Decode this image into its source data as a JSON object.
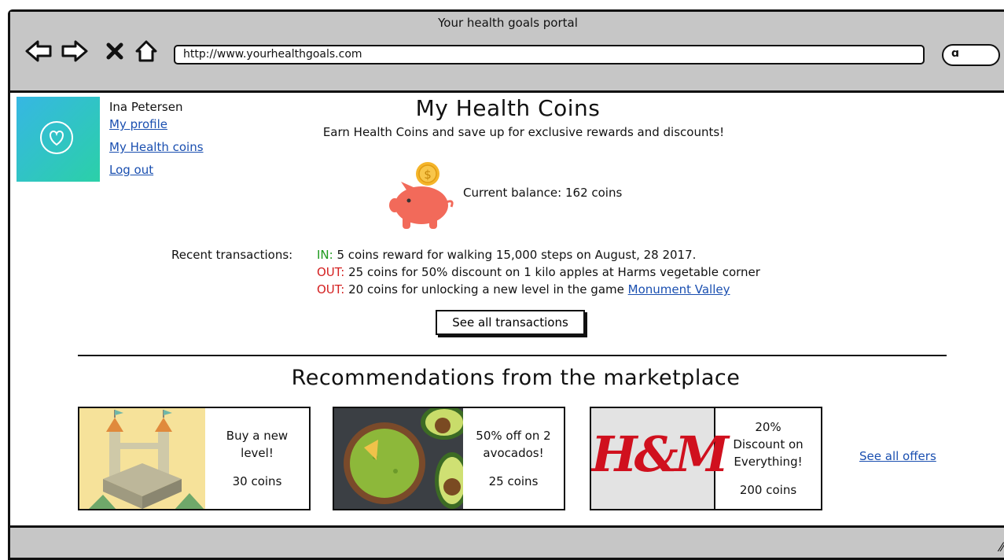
{
  "window": {
    "title": "Your health goals portal"
  },
  "toolbar": {
    "back_icon": "back-arrow-icon",
    "forward_icon": "forward-arrow-icon",
    "close_icon": "close-x-icon",
    "home_icon": "home-icon",
    "url": "http://www.yourhealthgoals.com",
    "search_icon": "search-icon"
  },
  "user": {
    "name": "Ina Petersen",
    "avatar_icon": "heart-icon",
    "links": [
      "My profile",
      "My Health coins",
      "Log out"
    ]
  },
  "main": {
    "title": "My Health Coins",
    "subtitle": "Earn Health Coins and save up for exclusive rewards and discounts!",
    "balance": "Current balance: 162 coins",
    "piggy_icon": "piggy-bank-icon",
    "coin_symbol": "$"
  },
  "transactions": {
    "label": "Recent transactions:",
    "items": [
      {
        "type": "IN:",
        "text": " 5 coins reward for walking 15,000 steps on August, 28 2017.",
        "link": ""
      },
      {
        "type": "OUT:",
        "text": " 25 coins for 50% discount on 1 kilo apples at Harms vegetable corner",
        "link": ""
      },
      {
        "type": "OUT:",
        "text": " 20 coins for unlocking a new level in the game ",
        "link": "Monument Valley"
      }
    ],
    "button": "See all transactions"
  },
  "marketplace": {
    "title": "Recommendations from the marketplace",
    "offers": [
      {
        "line1": "Buy a new",
        "line2": "level!",
        "line3": "",
        "coins": "30 coins",
        "image": "monument-valley-image"
      },
      {
        "line1": "50% off on 2",
        "line2": "avocados!",
        "line3": "",
        "coins": "25 coins",
        "image": "guacamole-image"
      },
      {
        "line1": "20%",
        "line2": "Discount on",
        "line3": "Everything!",
        "coins": "200 coins",
        "image": "hm-logo-image",
        "logo_text": "H&M"
      }
    ],
    "see_all": "See all offers"
  },
  "colors": {
    "chrome": "#c6c6c6",
    "link": "#1a4fb0",
    "in": "#1e9a1e",
    "out": "#d42020",
    "pig": "#f26a5a",
    "coin": "#f5b52a",
    "hm_red": "#d0101e"
  }
}
